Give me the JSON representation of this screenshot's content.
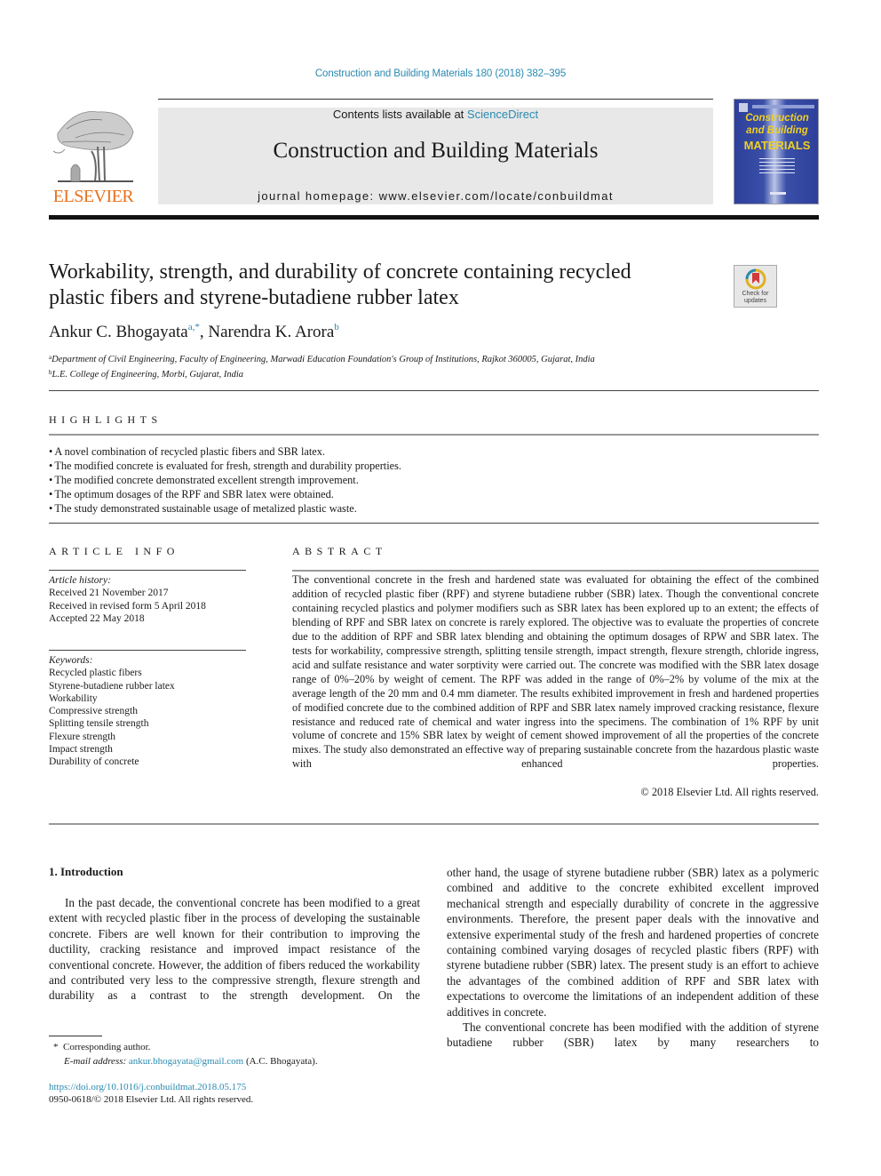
{
  "header": {
    "journal_ref": "Construction and Building Materials 180 (2018) 382–395",
    "contents_prefix": "Contents lists available at ",
    "contents_link": "ScienceDirect",
    "journal_title": "Construction and Building Materials",
    "homepage": "journal homepage: www.elsevier.com/locate/conbuildmat",
    "publisher_logo": "ELSEVIER",
    "cover": {
      "title_line1": "Construction",
      "title_line2": "and Building",
      "title_line3": "MATERIALS"
    },
    "colors": {
      "link": "#2a8ab0",
      "elsevier_orange": "#e9711c",
      "cover_blue": "#2d3f9a",
      "cover_yellow": "#f0d020"
    }
  },
  "article": {
    "title_line1": "Workability, strength, and durability of concrete containing recycled",
    "title_line2": "plastic fibers and styrene-butadiene rubber latex",
    "check_updates": {
      "line1": "Check for",
      "line2": "updates"
    },
    "authors": [
      {
        "name": "Ankur C. Bhogayata",
        "sup": "a,*"
      },
      {
        "name": "Narendra K. Arora",
        "sup": "b"
      }
    ],
    "author_separator": ", ",
    "affiliations": [
      {
        "key": "a",
        "text": "Department of Civil Engineering, Faculty of Engineering, Marwadi Education Foundation's Group of Institutions, Rajkot 360005, Gujarat, India"
      },
      {
        "key": "b",
        "text": "L.E. College of Engineering, Morbi, Gujarat, India"
      }
    ]
  },
  "highlights": {
    "heading": "HIGHLIGHTS",
    "items": [
      "A novel combination of recycled plastic fibers and SBR latex.",
      "The modified concrete is evaluated for fresh, strength and durability properties.",
      "The modified concrete demonstrated excellent strength improvement.",
      "The optimum dosages of the RPF and SBR latex were obtained.",
      "The study demonstrated sustainable usage of metalized plastic waste."
    ]
  },
  "article_info": {
    "heading": "ARTICLE INFO",
    "history_label": "Article history:",
    "history": [
      "Received 21 November 2017",
      "Received in revised form 5 April 2018",
      "Accepted 22 May 2018"
    ],
    "keywords_label": "Keywords:",
    "keywords": [
      "Recycled plastic fibers",
      "Styrene-butadiene rubber latex",
      "Workability",
      "Compressive strength",
      "Splitting tensile strength",
      "Flexure strength",
      "Impact strength",
      "Durability of concrete"
    ]
  },
  "abstract": {
    "heading": "ABSTRACT",
    "text": "The conventional concrete in the fresh and hardened state was evaluated for obtaining the effect of the combined addition of recycled plastic fiber (RPF) and styrene butadiene rubber (SBR) latex. Though the conventional concrete containing recycled plastics and polymer modifiers such as SBR latex has been explored up to an extent; the effects of blending of RPF and SBR latex on concrete is rarely explored. The objective was to evaluate the properties of concrete due to the addition of RPF and SBR latex blending and obtaining the optimum dosages of RPW and SBR latex. The tests for workability, compressive strength, splitting tensile strength, impact strength, flexure strength, chloride ingress, acid and sulfate resistance and water sorptivity were carried out. The concrete was modified with the SBR latex dosage range of 0%–20% by weight of cement. The RPF was added in the range of 0%–2% by volume of the mix at the average length of the 20 mm and 0.4 mm diameter. The results exhibited improvement in fresh and hardened properties of modified concrete due to the combined addition of RPF and SBR latex namely improved cracking resistance, flexure resistance and reduced rate of chemical and water ingress into the specimens. The combination of 1% RPF by unit volume of concrete and 15% SBR latex by weight of cement showed improvement of all the properties of the concrete mixes. The study also demonstrated an effec­tive way of preparing sustainable concrete from the hazardous plastic waste with enhanced properties.",
    "copyright": "© 2018 Elsevier Ltd. All rights reserved."
  },
  "introduction": {
    "heading": "1. Introduction",
    "col1_para1": "In the past decade, the conventional concrete has been modified to a great extent with recycled plastic fiber in the process of devel­oping the sustainable concrete. Fibers are well known for their con­tribution to improving the ductility, cracking resistance and improved impact resistance of the conventional concrete. How­ever, the addition of fibers reduced the workability and con­tributed very less to the compressive strength, flexure strength and durability as a contrast to the strength development. On the",
    "col2_para1": "other hand, the usage of styrene butadiene rubber (SBR) latex as a polymeric combined and additive to the concrete exhibited excellent improved mechanical strength and especially durability of concrete in the aggressive environments. Therefore, the present paper deals with the innovative and extensive experimental study of the fresh and hardened properties of concrete containing com­bined varying dosages of recycled plastic fibers (RPF) with styrene butadiene rubber (SBR) latex. The present study is an effort to achieve the advantages of the combined addition of RPF and SBR latex with expectations to overcome the limitations of an indepen­dent addition of these additives in concrete.",
    "col2_para2": "The conventional concrete has been modified with the addition of styrene butadiene rubber (SBR) latex by many researchers to"
  },
  "footnote": {
    "symbol": "*",
    "corresponding": "Corresponding author.",
    "email_label": "E-mail address: ",
    "email": "ankur.bhogayata@gmail.com",
    "email_suffix": " (A.C. Bhogayata)."
  },
  "footer": {
    "doi": "https://doi.org/10.1016/j.conbuildmat.2018.05.175",
    "issn_copyright": "0950-0618/© 2018 Elsevier Ltd. All rights reserved."
  }
}
